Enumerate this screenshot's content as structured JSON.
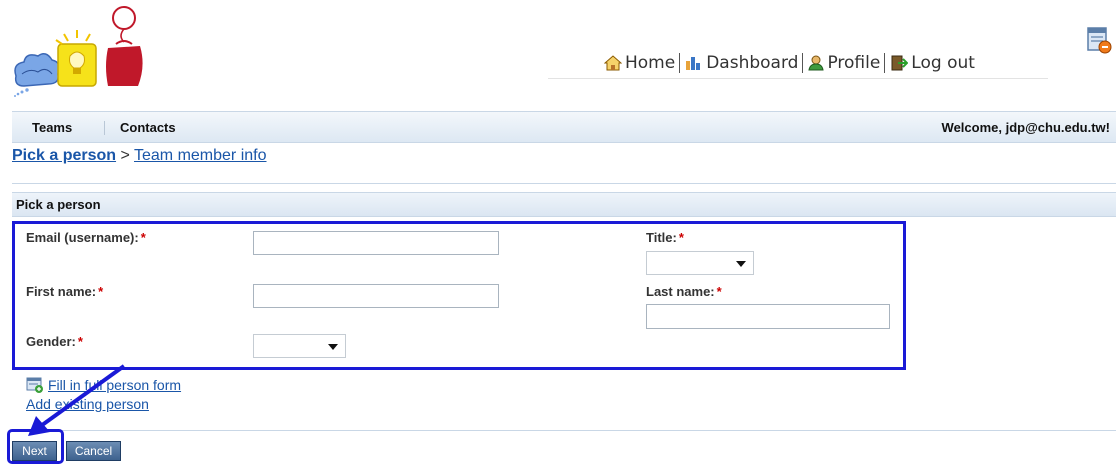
{
  "topnav": {
    "home": "Home",
    "dashboard": "Dashboard",
    "profile": "Profile",
    "logout": "Log out"
  },
  "menu": {
    "items": [
      "Teams",
      "Contacts"
    ],
    "welcome": "Welcome, jdp@chu.edu.tw!"
  },
  "breadcrumb": {
    "current": "Pick a person",
    "separator": ">",
    "next": "Team member info"
  },
  "panel": {
    "title": "Pick a person",
    "fields": {
      "email_label": "Email (username):",
      "firstname_label": "First name:",
      "gender_label": "Gender:",
      "title_label": "Title:",
      "lastname_label": "Last name:",
      "required_mark": "*"
    }
  },
  "links": {
    "fill_full_form": "Fill in full person form",
    "add_existing": "Add existing person"
  },
  "buttons": {
    "next": "Next",
    "cancel": "Cancel"
  },
  "colors": {
    "link": "#1a56a8",
    "annotation": "#1a1ad6",
    "required": "#cc0000"
  }
}
